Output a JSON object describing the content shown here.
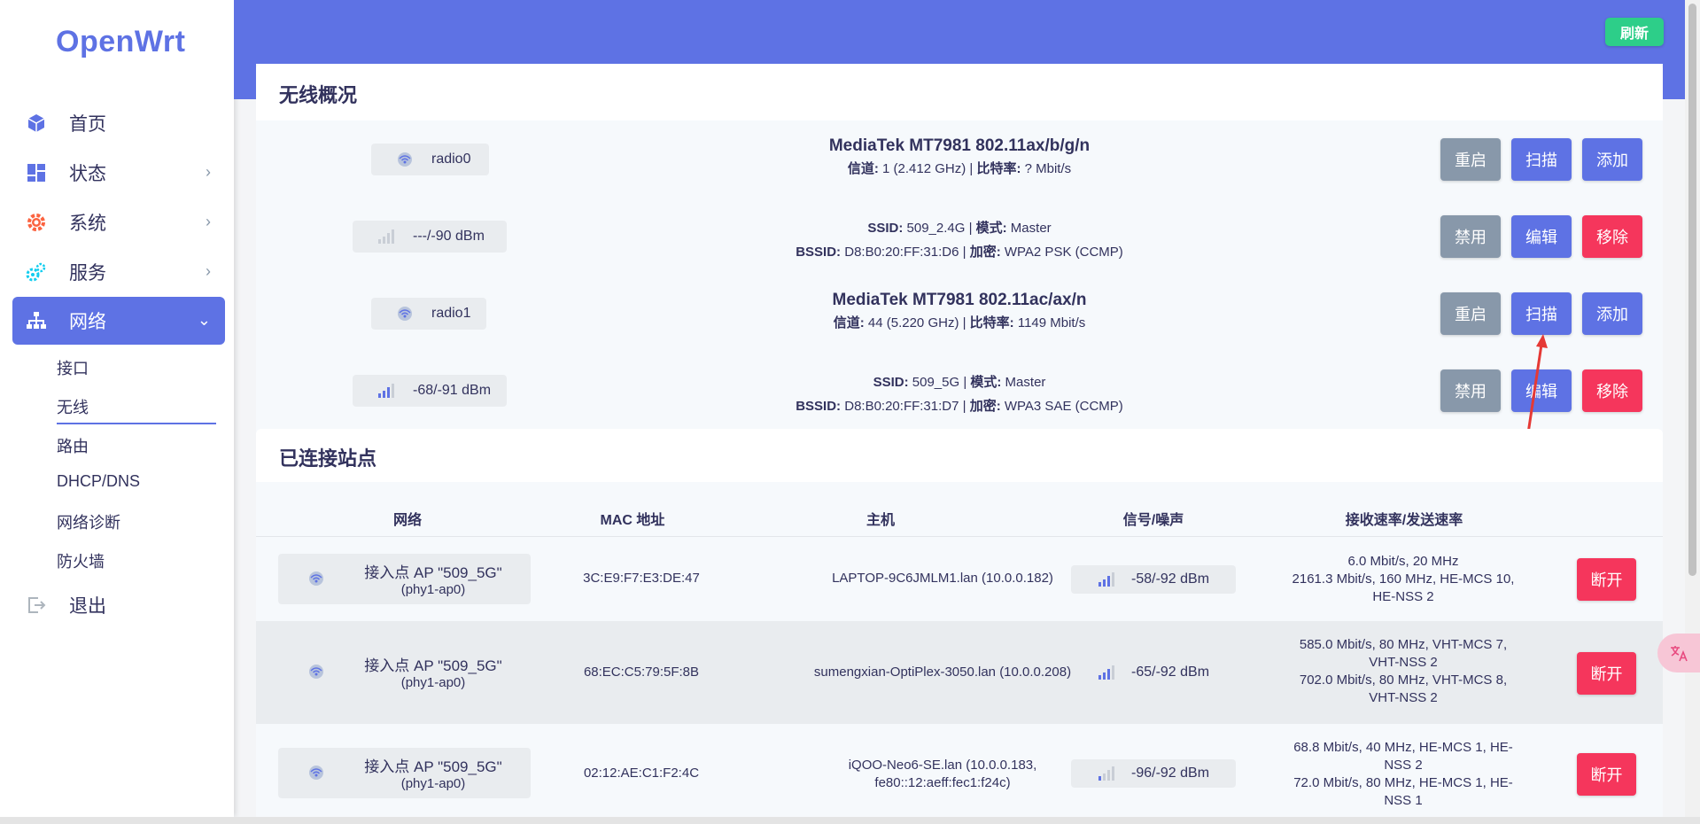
{
  "app": {
    "logo": "OpenWrt",
    "refresh": "刷新"
  },
  "sidebar": {
    "items": [
      {
        "label": "首页",
        "icon": "cube-icon"
      },
      {
        "label": "状态",
        "icon": "dashboard-icon"
      },
      {
        "label": "系统",
        "icon": "gear-icon"
      },
      {
        "label": "服务",
        "icon": "gears-icon"
      },
      {
        "label": "网络",
        "icon": "network-icon"
      },
      {
        "label": "退出",
        "icon": "logout-icon"
      }
    ],
    "sub": [
      "接口",
      "无线",
      "路由",
      "DHCP/DNS",
      "网络诊断",
      "防火墙"
    ],
    "active_sub": "无线"
  },
  "wireless": {
    "title": "无线概况",
    "rows": [
      {
        "badge": "radio0",
        "title": "MediaTek MT7981 802.11ax/b/g/n",
        "k1": "信道:",
        "v1": " 1 (2.412 GHz) | ",
        "k2": "比特率:",
        "v2": " ? Mbit/s",
        "btn1": "重启",
        "btn2": "扫描",
        "btn3": "添加"
      },
      {
        "badge": "---/-90 dBm",
        "l1k": "SSID:",
        "l1v": " 509_2.4G | ",
        "l1k2": "模式:",
        "l1v2": " Master",
        "l2k": "BSSID:",
        "l2v": " D8:B0:20:FF:31:D6 | ",
        "l2k2": "加密:",
        "l2v2": " WPA2 PSK (CCMP)",
        "btn1": "禁用",
        "btn2": "编辑",
        "btn3": "移除"
      },
      {
        "badge": "radio1",
        "title": "MediaTek MT7981 802.11ac/ax/n",
        "k1": "信道:",
        "v1": " 44 (5.220 GHz) | ",
        "k2": "比特率:",
        "v2": " 1149 Mbit/s",
        "btn1": "重启",
        "btn2": "扫描",
        "btn3": "添加"
      },
      {
        "badge": "-68/-91 dBm",
        "l1k": "SSID:",
        "l1v": " 509_5G | ",
        "l1k2": "模式:",
        "l1v2": " Master",
        "l2k": "BSSID:",
        "l2v": " D8:B0:20:FF:31:D7 | ",
        "l2k2": "加密:",
        "l2v2": " WPA3 SAE (CCMP)",
        "btn1": "禁用",
        "btn2": "编辑",
        "btn3": "移除"
      }
    ]
  },
  "stations": {
    "title": "已连接站点",
    "headers": [
      "网络",
      "MAC 地址",
      "主机",
      "信号/噪声",
      "接收速率/发送速率"
    ],
    "rows": [
      {
        "net1": "接入点 AP \"509_5G\"",
        "net2": "(phy1-ap0)",
        "mac": "3C:E9:F7:E3:DE:47",
        "host1": "LAPTOP-9C6JMLM1.lan (10.0.0.182)",
        "host2": "",
        "signal": "-58/-92 dBm",
        "rate": [
          "6.0 Mbit/s, 20 MHz",
          "2161.3 Mbit/s, 160 MHz, HE-MCS 10,",
          "HE-NSS 2"
        ],
        "action": "断开"
      },
      {
        "net1": "接入点 AP \"509_5G\"",
        "net2": "(phy1-ap0)",
        "mac": "68:EC:C5:79:5F:8B",
        "host1": "sumengxian-OptiPlex-3050.lan (10.0.0.208)",
        "host2": "",
        "signal": "-65/-92 dBm",
        "rate": [
          "585.0 Mbit/s, 80 MHz, VHT-MCS 7,",
          "VHT-NSS 2",
          "702.0 Mbit/s, 80 MHz, VHT-MCS 8,",
          "VHT-NSS 2"
        ],
        "action": "断开"
      },
      {
        "net1": "接入点 AP \"509_5G\"",
        "net2": "(phy1-ap0)",
        "mac": "02:12:AE:C1:F2:4C",
        "host1": "iQOO-Neo6-SE.lan (10.0.0.183,",
        "host2": "fe80::12:aeff:fec1:f24c)",
        "signal": "-96/-92 dBm",
        "rate": [
          "68.8 Mbit/s, 40 MHz, HE-MCS 1, HE-",
          "NSS 2",
          "72.0 Mbit/s, 80 MHz, HE-MCS 1, HE-",
          "NSS 1"
        ],
        "action": "断开"
      }
    ]
  },
  "colors": {
    "accent": "#5e72e4",
    "danger": "#f5365c",
    "success": "#2dce89",
    "muted": "#8898aa"
  }
}
